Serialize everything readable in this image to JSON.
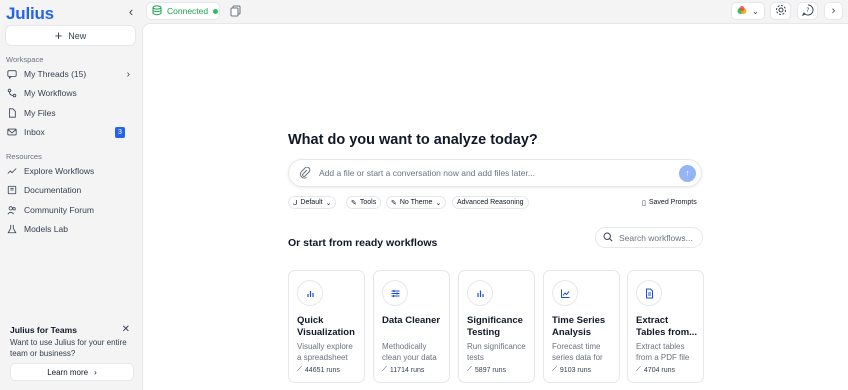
{
  "app": {
    "logo": "Julius"
  },
  "sidebar": {
    "new_label": "New",
    "workspace_label": "Workspace",
    "workspace_items": [
      {
        "label": "My Threads (15)",
        "icon": "chat-icon"
      },
      {
        "label": "My Workflows",
        "icon": "workflow-icon"
      },
      {
        "label": "My Files",
        "icon": "file-icon"
      },
      {
        "label": "Inbox",
        "icon": "mail-icon",
        "badge": "3"
      }
    ],
    "resources_label": "Resources",
    "resource_items": [
      {
        "label": "Explore Workflows",
        "icon": "trend-icon"
      },
      {
        "label": "Documentation",
        "icon": "book-icon"
      },
      {
        "label": "Community Forum",
        "icon": "users-icon"
      },
      {
        "label": "Models Lab",
        "icon": "flask-icon"
      }
    ],
    "teams": {
      "title": "Julius for Teams",
      "description": "Want to use Julius for your entire team or business?",
      "button": "Learn more"
    }
  },
  "topbar": {
    "status": "Connected",
    "status_color": "#16a34a"
  },
  "main": {
    "headline": "What do you want to analyze today?",
    "input_placeholder": "Add a file or start a conversation now and add files later...",
    "pills": {
      "default": "Default",
      "tools": "Tools",
      "theme": "No Theme",
      "reasoning": "Advanced Reasoning",
      "saved": "Saved Prompts"
    },
    "workflows_heading": "Or start from ready workflows",
    "search_placeholder": "Search workflows...",
    "cards": [
      {
        "title": "Quick Visualization",
        "desc": "Visually explore a spreadsheet",
        "runs": "44651 runs",
        "icon": "bar-chart-icon"
      },
      {
        "title": "Data Cleaner",
        "desc": "Methodically clean your data",
        "runs": "11714 runs",
        "icon": "sliders-icon"
      },
      {
        "title": "Significance Testing",
        "desc": "Run significance tests",
        "runs": "5897 runs",
        "icon": "bar-chart-icon"
      },
      {
        "title": "Time Series Analysis",
        "desc": "Forecast time series data for",
        "runs": "9103 runs",
        "icon": "line-chart-icon"
      },
      {
        "title": "Extract Tables from...",
        "desc": "Extract tables from a PDF file",
        "runs": "4704 runs",
        "icon": "document-icon"
      }
    ]
  },
  "colors": {
    "accent": "#2563eb",
    "status_green": "#22c55e"
  }
}
